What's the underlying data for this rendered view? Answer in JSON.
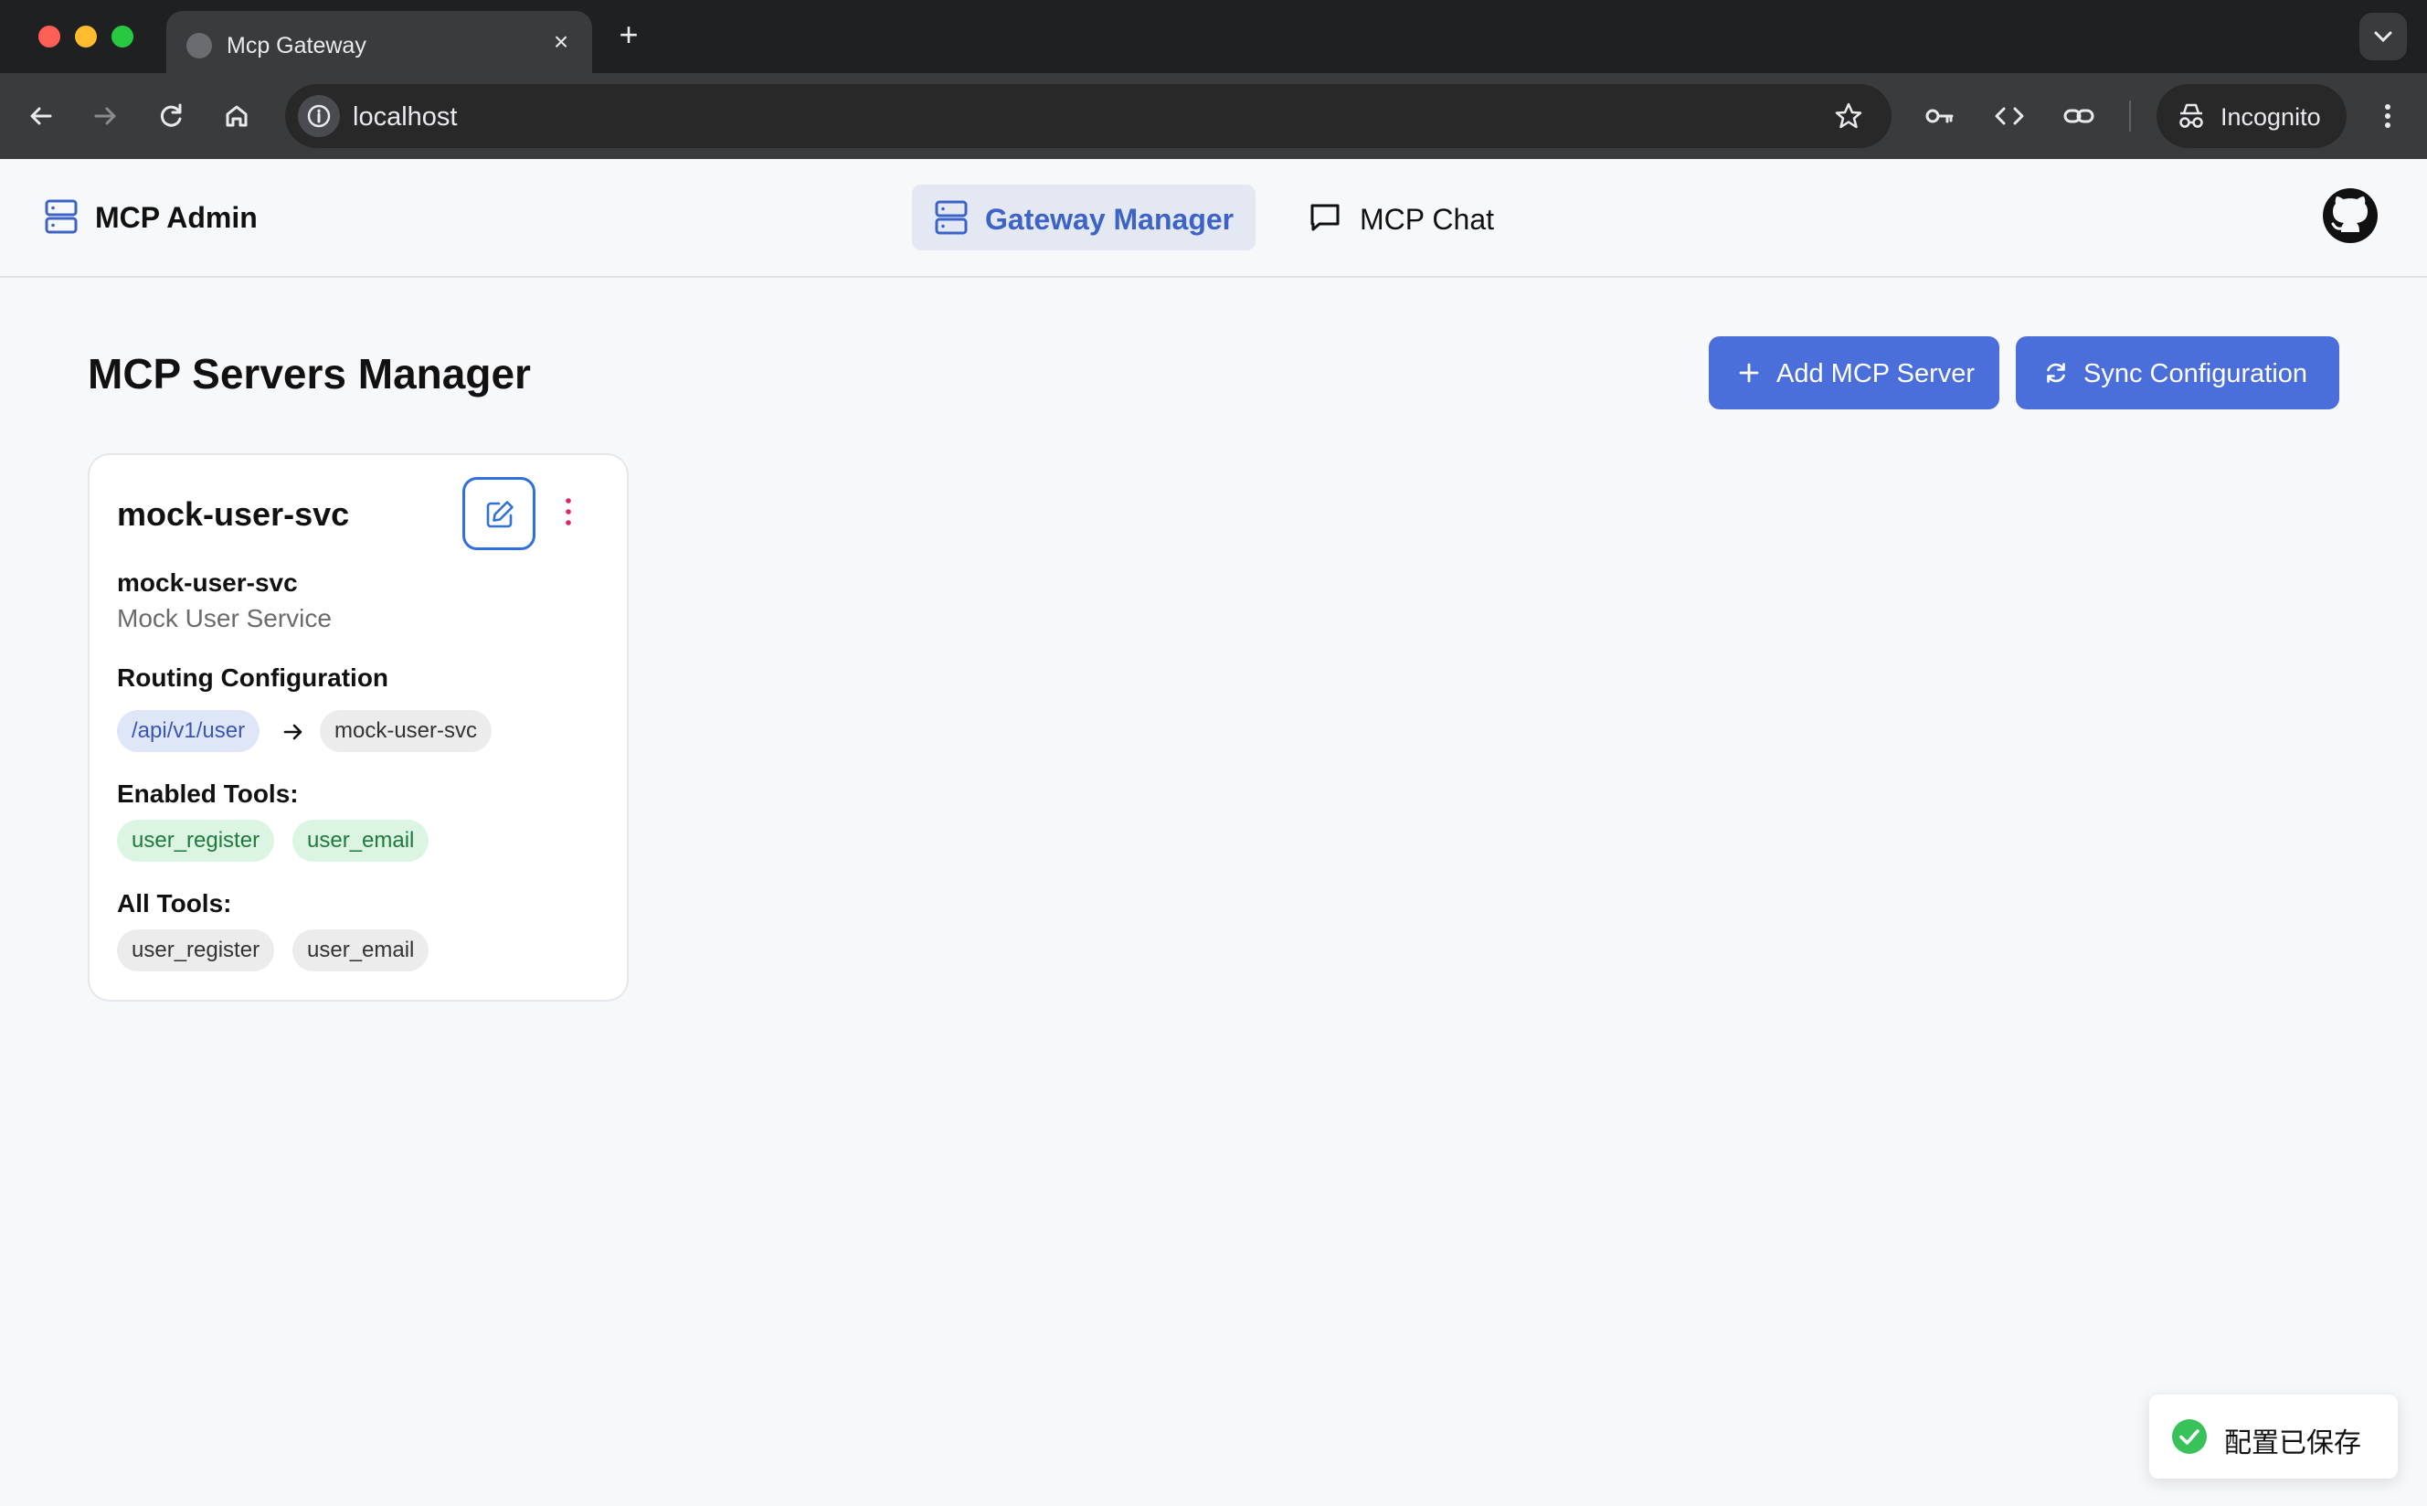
{
  "browser": {
    "tab_title": "Mcp Gateway",
    "url": "localhost",
    "incognito_label": "Incognito"
  },
  "header": {
    "brand": "MCP Admin",
    "nav": [
      {
        "label": "Gateway Manager",
        "active": true
      },
      {
        "label": "MCP Chat",
        "active": false
      }
    ]
  },
  "main": {
    "title": "MCP Servers Manager",
    "add_button": "Add MCP Server",
    "sync_button": "Sync Configuration",
    "card": {
      "title": "mock-user-svc",
      "name": "mock-user-svc",
      "description": "Mock User Service",
      "routing_label": "Routing Configuration",
      "route_path": "/api/v1/user",
      "route_target": "mock-user-svc",
      "enabled_tools_label": "Enabled Tools:",
      "enabled_tools": [
        "user_register",
        "user_email"
      ],
      "all_tools_label": "All Tools:",
      "all_tools": [
        "user_register",
        "user_email"
      ]
    }
  },
  "toast": {
    "message": "配置已保存"
  },
  "colors": {
    "accent": "#4a6fdb",
    "active_nav_bg": "#e3e8f3",
    "active_nav_text": "#3d63c9",
    "enabled_chip_bg": "#dcf5e3",
    "toast_success": "#3ac25a"
  }
}
